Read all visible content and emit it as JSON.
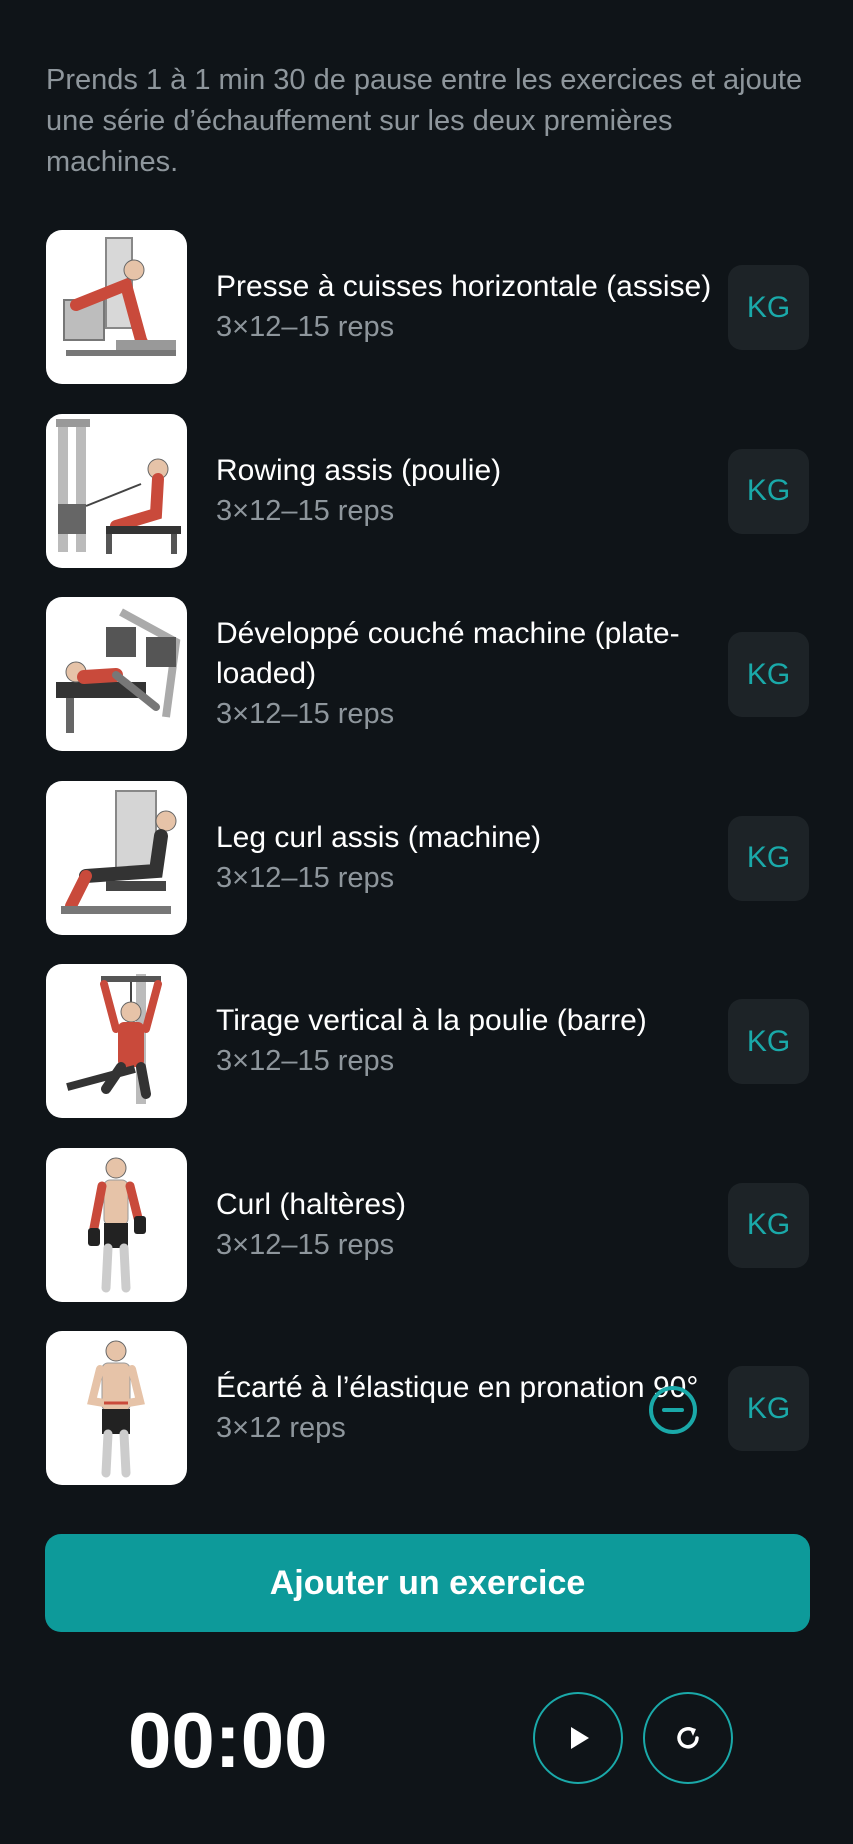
{
  "note": "Prends 1 à 1 min 30 de pause entre les exercices et ajoute une série d’échauffement sur les deux premières machines.",
  "exercises": [
    {
      "name": "Presse à cuisses horizontale (assise)",
      "reps": "3×12–15 reps",
      "unit": "KG"
    },
    {
      "name": "Rowing assis (poulie)",
      "reps": "3×12–15 reps",
      "unit": "KG"
    },
    {
      "name": "Développé couché machine (plate-loaded)",
      "reps": "3×12–15 reps",
      "unit": "KG"
    },
    {
      "name": "Leg curl assis (machine)",
      "reps": "3×12–15 reps",
      "unit": "KG"
    },
    {
      "name": "Tirage vertical à la poulie (barre)",
      "reps": "3×12–15 reps",
      "unit": "KG"
    },
    {
      "name": "Curl (haltères)",
      "reps": "3×12–15 reps",
      "unit": "KG"
    },
    {
      "name": "Écarté à l’élastique en pronation 90°",
      "reps": "3×12 reps",
      "unit": "KG"
    }
  ],
  "add_button": "Ajouter un exercice",
  "timer": "00:00",
  "icons": {
    "play": "play-icon",
    "reset": "refresh-icon",
    "remove": "minus-circle-icon"
  },
  "colors": {
    "accent": "#0d9a9a",
    "background": "#0f1418",
    "muted": "#8e969c"
  }
}
